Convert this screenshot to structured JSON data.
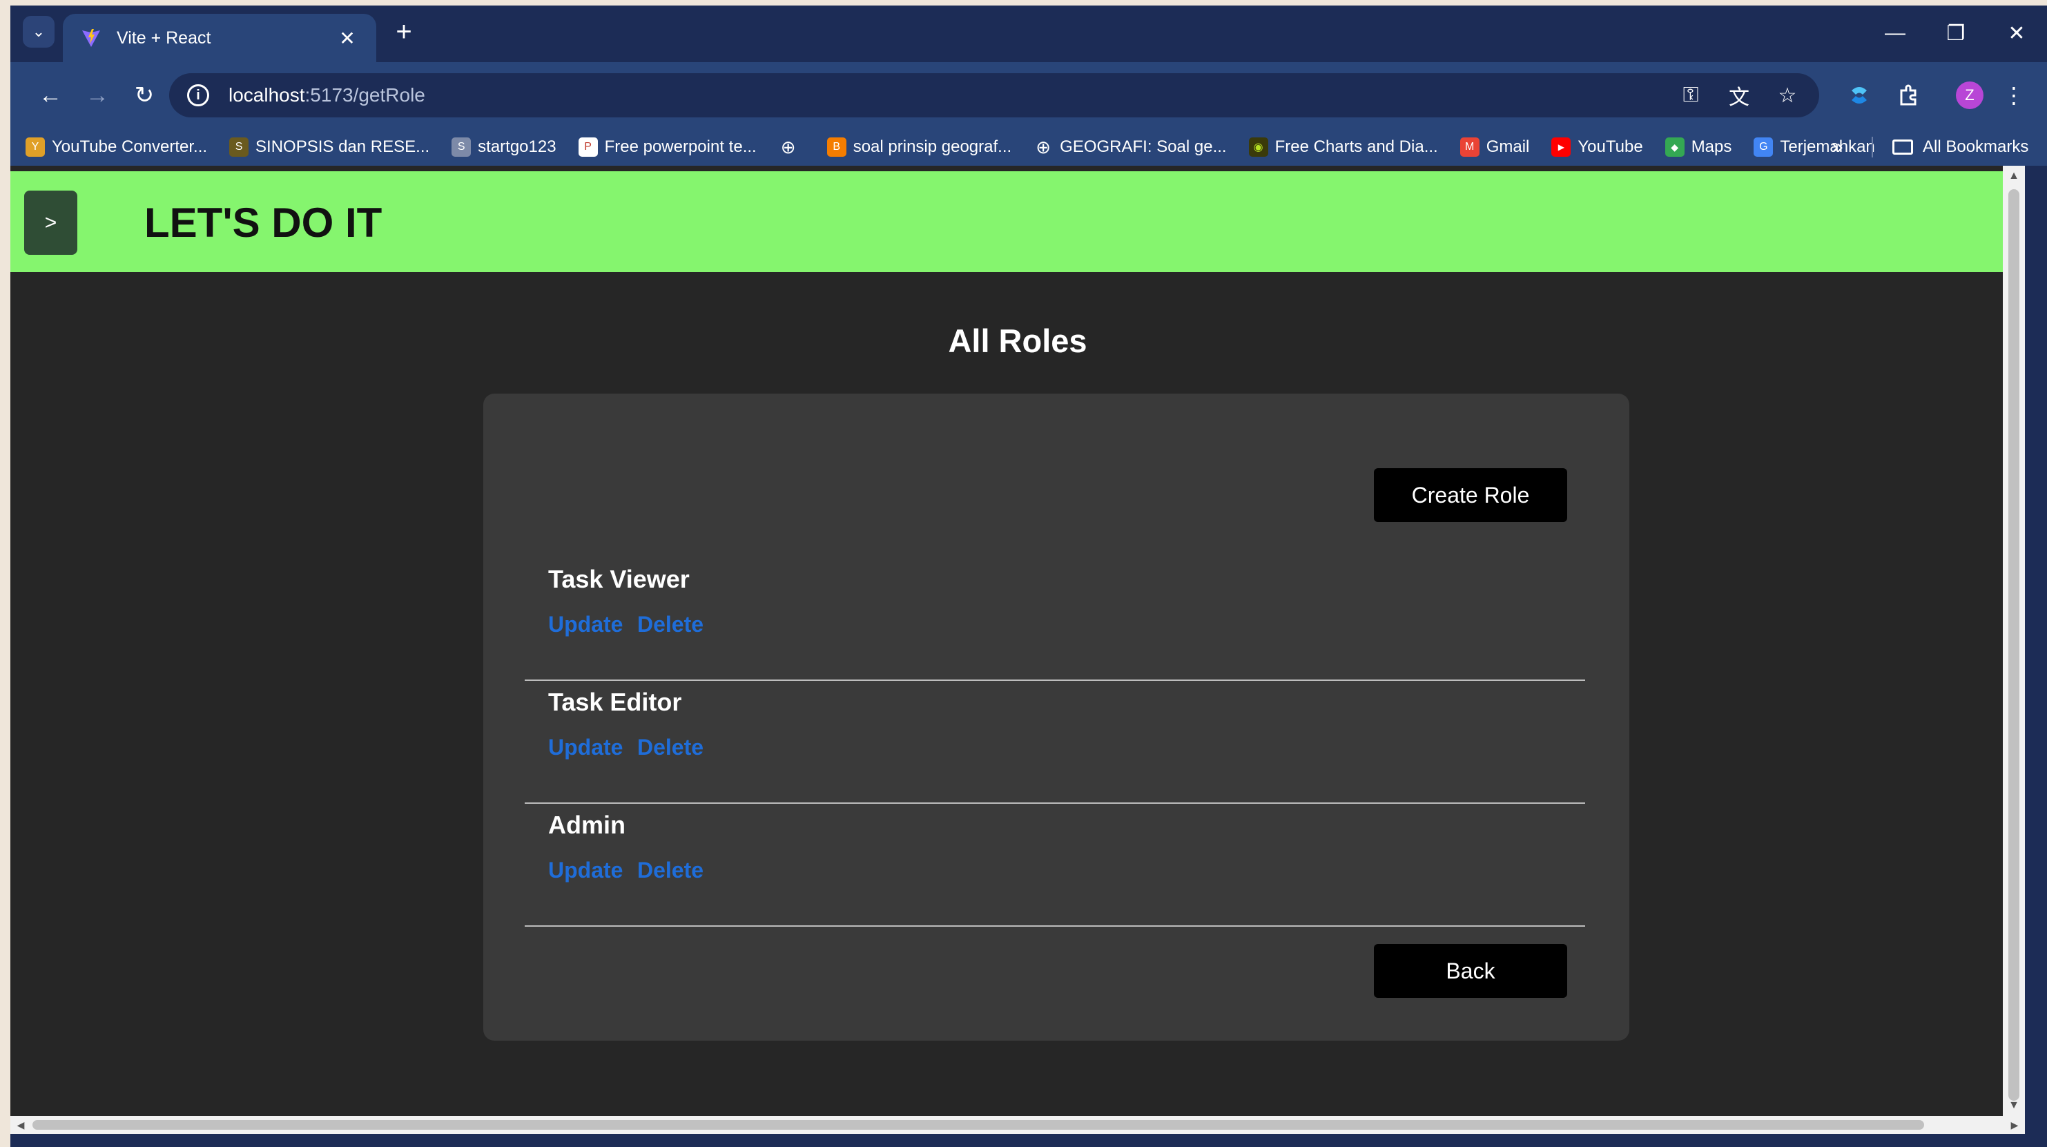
{
  "browser": {
    "tab": {
      "title": "Vite + React",
      "close": "✕",
      "icon": "vite-logo-icon"
    },
    "new_tab": "+",
    "tab_menu": "⌄",
    "window_controls": {
      "minimize": "—",
      "restore": "❐",
      "close": "✕"
    },
    "nav": {
      "back": "←",
      "forward": "→",
      "reload": "↻"
    },
    "url": {
      "host": "localhost",
      "path": ":5173/getRole"
    },
    "bookmarks": [
      {
        "label": "YouTube Converter...",
        "color": "#e0a028",
        "icon": "Y"
      },
      {
        "label": "SINOPSIS dan RESE...",
        "color": "#6a5a1e",
        "icon": "S"
      },
      {
        "label": "startgo123",
        "color": "#7d8aa8",
        "icon": "S"
      },
      {
        "label": "Free powerpoint te...",
        "color": "#ffffff",
        "icon": "P"
      },
      {
        "label": "",
        "color": "#294579",
        "icon": "⊕"
      },
      {
        "label": "soal prinsip geograf...",
        "color": "#f57d00",
        "icon": "B"
      },
      {
        "label": "GEOGRAFI: Soal ge...",
        "color": "#294579",
        "icon": "⊕"
      },
      {
        "label": "Free Charts and Dia...",
        "color": "#3a3a0a",
        "icon": "◉"
      },
      {
        "label": "Gmail",
        "color": "#ea4335",
        "icon": "M"
      },
      {
        "label": "YouTube",
        "color": "#ff0000",
        "icon": "▶"
      },
      {
        "label": "Maps",
        "color": "#34a853",
        "icon": "◆"
      },
      {
        "label": "Terjemahkan",
        "color": "#4285f4",
        "icon": "G"
      }
    ],
    "bookmarks_more": "»",
    "all_bookmarks": "All Bookmarks",
    "profile_initial": "Z"
  },
  "app": {
    "menu_toggle": ">",
    "title": "LET'S DO IT",
    "page_title": "All Roles",
    "create_button": "Create Role",
    "back_button": "Back",
    "update_label": "Update",
    "delete_label": "Delete",
    "roles": [
      {
        "name": "Task Viewer"
      },
      {
        "name": "Task Editor"
      },
      {
        "name": "Admin"
      }
    ],
    "colors": {
      "header": "#85f56e",
      "link": "#1f6dd9",
      "card": "#3a3a3a",
      "background": "#262626"
    }
  }
}
